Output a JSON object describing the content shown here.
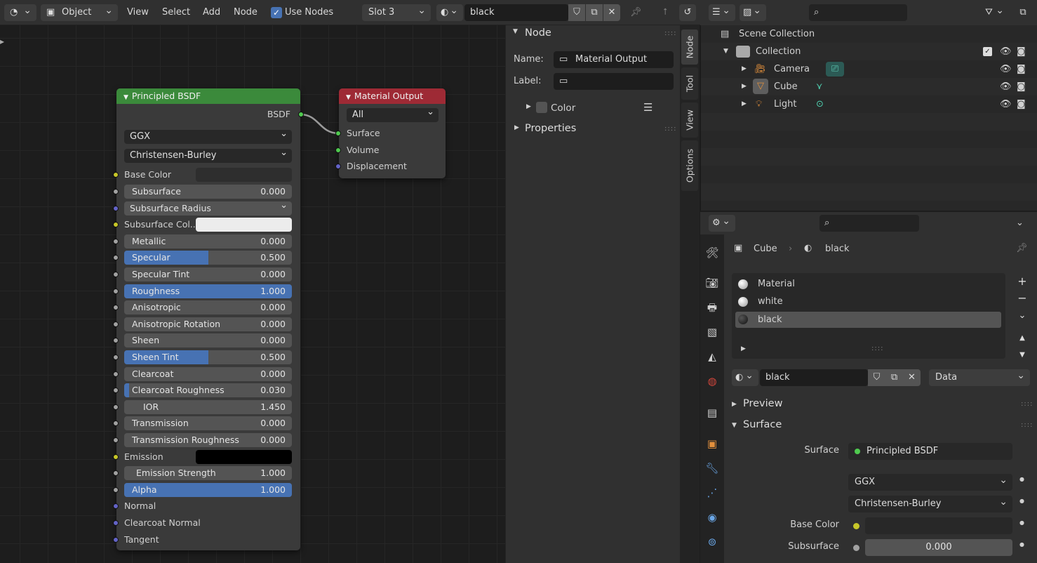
{
  "header": {
    "mode": "Object",
    "menus": [
      "View",
      "Select",
      "Add",
      "Node"
    ],
    "use_nodes_label": "Use Nodes",
    "use_nodes_checked": true,
    "slot": "Slot 3",
    "material_name": "black"
  },
  "principled_node": {
    "title": "Principled BSDF",
    "output": "BSDF",
    "distribution": "GGX",
    "subsurface_method": "Christensen-Burley",
    "base_color_label": "Base Color",
    "subsurface_color_label": "Subsurface Col...",
    "subsurface_radius": "Subsurface Radius",
    "emission_label": "Emission",
    "normal_label": "Normal",
    "clearcoat_normal_label": "Clearcoat Normal",
    "tangent_label": "Tangent",
    "inputs": [
      {
        "label": "Subsurface",
        "value": "0.000",
        "fill": 0
      },
      {
        "label": "Metallic",
        "value": "0.000",
        "fill": 0
      },
      {
        "label": "Specular",
        "value": "0.500",
        "fill": 0.5
      },
      {
        "label": "Specular Tint",
        "value": "0.000",
        "fill": 0
      },
      {
        "label": "Roughness",
        "value": "1.000",
        "fill": 1
      },
      {
        "label": "Anisotropic",
        "value": "0.000",
        "fill": 0
      },
      {
        "label": "Anisotropic Rotation",
        "value": "0.000",
        "fill": 0
      },
      {
        "label": "Sheen",
        "value": "0.000",
        "fill": 0
      },
      {
        "label": "Sheen Tint",
        "value": "0.500",
        "fill": 0.5
      },
      {
        "label": "Clearcoat",
        "value": "0.000",
        "fill": 0
      },
      {
        "label": "Clearcoat Roughness",
        "value": "0.030",
        "fill": 0.03
      },
      {
        "label": "IOR",
        "value": "1.450",
        "fill": 0
      },
      {
        "label": "Transmission",
        "value": "0.000",
        "fill": 0
      },
      {
        "label": "Transmission Roughness",
        "value": "0.000",
        "fill": 0
      },
      {
        "label": "Emission Strength",
        "value": "1.000",
        "fill": 0
      },
      {
        "label": "Alpha",
        "value": "1.000",
        "fill": 1
      }
    ]
  },
  "output_node": {
    "title": "Material Output",
    "target": "All",
    "surface": "Surface",
    "volume": "Volume",
    "displacement": "Displacement"
  },
  "side_panel": {
    "node_header": "Node",
    "name_label": "Name:",
    "name_value": "Material Output",
    "label_label": "Label:",
    "label_value": "",
    "color_label": "Color",
    "properties_label": "Properties",
    "tabs": [
      "Node",
      "Tool",
      "View",
      "Options"
    ]
  },
  "outliner": {
    "scene_collection": "Scene Collection",
    "collection": "Collection",
    "items": [
      "Camera",
      "Cube",
      "Light"
    ]
  },
  "properties": {
    "breadcrumb_object": "Cube",
    "breadcrumb_material": "black",
    "slots": [
      "Material",
      "white",
      "black"
    ],
    "active_slot": "black",
    "material_name": "black",
    "link": "Data",
    "preview_label": "Preview",
    "surface_section": "Surface",
    "surface_label": "Surface",
    "surface_value": "Principled BSDF",
    "distribution": "GGX",
    "subsurface_method": "Christensen-Burley",
    "base_color_label": "Base Color",
    "subsurface_label": "Subsurface",
    "subsurface_value": "0.000"
  },
  "colors": {
    "accent": "#4772b3",
    "principled_header": "#3b8a3b",
    "output_header": "#9e2a35"
  }
}
